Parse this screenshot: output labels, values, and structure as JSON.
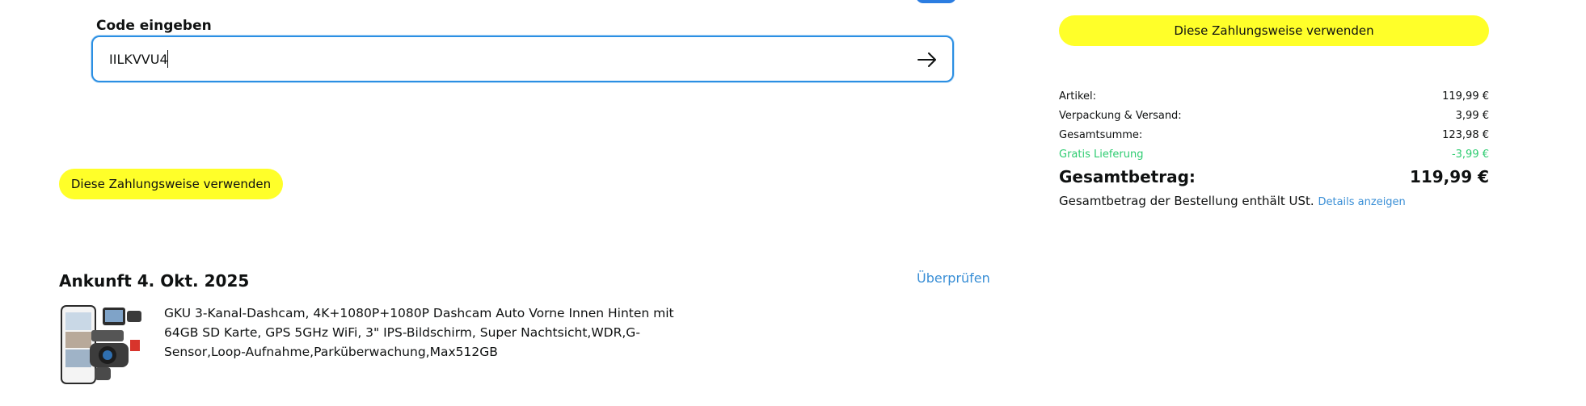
{
  "promo": {
    "label": "Code eingeben",
    "value": "IILKVVU4",
    "submit_icon": "arrow-right-icon"
  },
  "buttons": {
    "use_payment_method": "Diese Zahlungsweise verwenden"
  },
  "summary": {
    "rows": [
      {
        "label": "Artikel:",
        "value": "119,99 €"
      },
      {
        "label": "Verpackung & Versand:",
        "value": "3,99 €"
      },
      {
        "label": "Gesamtsumme:",
        "value": "123,98 €"
      },
      {
        "label": "Gratis Lieferung",
        "value": "-3,99 €"
      }
    ],
    "total_label": "Gesamtbetrag:",
    "total_value": "119,99 €",
    "vat_note": "Gesamtbetrag der Bestellung enthält USt.",
    "details_link": "Details anzeigen"
  },
  "delivery": {
    "arrival": "Ankunft 4. Okt. 2025",
    "review_link": "Überprüfen",
    "product": {
      "title": "GKU 3-Kanal-Dashcam, 4K+1080P+1080P Dashcam Auto Vorne Innen Hinten mit 64GB SD Karte, GPS 5GHz WiFi, 3\" IPS-Bildschirm, Super Nachtsicht,WDR,G-Sensor,Loop-Aufnahme,Parküberwachung,Max512GB"
    }
  },
  "colors": {
    "button_yellow": "#ffff29",
    "focus_blue": "#2b8fe3",
    "link_blue": "#3a8fd6",
    "free_green": "#2ecc71"
  }
}
